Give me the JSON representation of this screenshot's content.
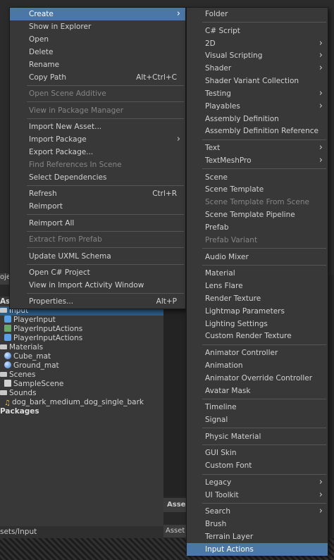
{
  "project_panel": {
    "tab_label": "oje",
    "header_label": "Asse",
    "tree": [
      {
        "label": "Input",
        "icon": "folder",
        "selected": true,
        "indent": 0
      },
      {
        "label": "PlayerInput",
        "icon": "input-actions",
        "indent": 1
      },
      {
        "label": "PlayerInputActions",
        "icon": "csharp-script",
        "indent": 1
      },
      {
        "label": "PlayerInputActions",
        "icon": "input-actions",
        "indent": 1
      },
      {
        "label": "Materials",
        "icon": "folder",
        "indent": 0
      },
      {
        "label": "Cube_mat",
        "icon": "material-sphere",
        "indent": 1
      },
      {
        "label": "Ground_mat",
        "icon": "material-sphere",
        "indent": 1
      },
      {
        "label": "Scenes",
        "icon": "folder",
        "indent": 0
      },
      {
        "label": "SampleScene",
        "icon": "scene",
        "indent": 1
      },
      {
        "label": "Sounds",
        "icon": "folder",
        "indent": 0
      },
      {
        "label": "dog_bark_medium_dog_single_bark",
        "icon": "audio",
        "indent": 1
      }
    ],
    "packages_label": "Packages",
    "breadcrumb": "sets/Input",
    "assets_tab_label": "Asse",
    "assets_path_label": "Asset"
  },
  "context_menu": {
    "groups": [
      [
        {
          "label": "Create",
          "submenu": true,
          "highlighted": true
        },
        {
          "label": "Show in Explorer"
        },
        {
          "label": "Open"
        },
        {
          "label": "Delete"
        },
        {
          "label": "Rename"
        },
        {
          "label": "Copy Path",
          "shortcut": "Alt+Ctrl+C"
        }
      ],
      [
        {
          "label": "Open Scene Additive",
          "disabled": true
        }
      ],
      [
        {
          "label": "View in Package Manager",
          "disabled": true
        }
      ],
      [
        {
          "label": "Import New Asset..."
        },
        {
          "label": "Import Package",
          "submenu": true
        },
        {
          "label": "Export Package..."
        },
        {
          "label": "Find References In Scene",
          "disabled": true
        },
        {
          "label": "Select Dependencies"
        }
      ],
      [
        {
          "label": "Refresh",
          "shortcut": "Ctrl+R"
        },
        {
          "label": "Reimport"
        }
      ],
      [
        {
          "label": "Reimport All"
        }
      ],
      [
        {
          "label": "Extract From Prefab",
          "disabled": true
        }
      ],
      [
        {
          "label": "Update UXML Schema"
        }
      ],
      [
        {
          "label": "Open C# Project"
        },
        {
          "label": "View in Import Activity Window"
        }
      ],
      [
        {
          "label": "Properties...",
          "shortcut": "Alt+P"
        }
      ]
    ]
  },
  "create_submenu": {
    "groups": [
      [
        {
          "label": "Folder"
        }
      ],
      [
        {
          "label": "C# Script"
        },
        {
          "label": "2D",
          "submenu": true
        },
        {
          "label": "Visual Scripting",
          "submenu": true
        },
        {
          "label": "Shader",
          "submenu": true
        },
        {
          "label": "Shader Variant Collection"
        },
        {
          "label": "Testing",
          "submenu": true
        },
        {
          "label": "Playables",
          "submenu": true
        },
        {
          "label": "Assembly Definition"
        },
        {
          "label": "Assembly Definition Reference"
        }
      ],
      [
        {
          "label": "Text",
          "submenu": true
        },
        {
          "label": "TextMeshPro",
          "submenu": true
        }
      ],
      [
        {
          "label": "Scene"
        },
        {
          "label": "Scene Template"
        },
        {
          "label": "Scene Template From Scene",
          "disabled": true
        },
        {
          "label": "Scene Template Pipeline"
        },
        {
          "label": "Prefab"
        },
        {
          "label": "Prefab Variant",
          "disabled": true
        }
      ],
      [
        {
          "label": "Audio Mixer"
        }
      ],
      [
        {
          "label": "Material"
        },
        {
          "label": "Lens Flare"
        },
        {
          "label": "Render Texture"
        },
        {
          "label": "Lightmap Parameters"
        },
        {
          "label": "Lighting Settings"
        },
        {
          "label": "Custom Render Texture"
        }
      ],
      [
        {
          "label": "Animator Controller"
        },
        {
          "label": "Animation"
        },
        {
          "label": "Animator Override Controller"
        },
        {
          "label": "Avatar Mask"
        }
      ],
      [
        {
          "label": "Timeline"
        },
        {
          "label": "Signal"
        }
      ],
      [
        {
          "label": "Physic Material"
        }
      ],
      [
        {
          "label": "GUI Skin"
        },
        {
          "label": "Custom Font"
        }
      ],
      [
        {
          "label": "Legacy",
          "submenu": true
        },
        {
          "label": "UI Toolkit",
          "submenu": true
        }
      ],
      [
        {
          "label": "Search",
          "submenu": true
        },
        {
          "label": "Brush"
        },
        {
          "label": "Terrain Layer"
        },
        {
          "label": "Input Actions",
          "highlighted": true
        }
      ]
    ]
  }
}
